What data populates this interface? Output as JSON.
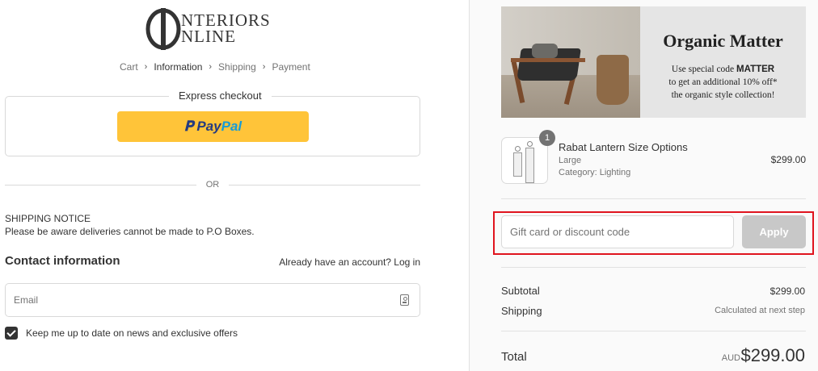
{
  "brand": {
    "logo_line1": "NTERIORS",
    "logo_line2": "NLINE",
    "logo_mark": "IO"
  },
  "breadcrumb": {
    "items": [
      "Cart",
      "Information",
      "Shipping",
      "Payment"
    ],
    "active": "Information"
  },
  "express": {
    "title": "Express checkout",
    "paypal_pay": "Pay",
    "paypal_pal": "Pal"
  },
  "divider_text": "OR",
  "notice": {
    "title": "SHIPPING NOTICE",
    "text": "Please be aware deliveries cannot be made to P.O Boxes."
  },
  "contact": {
    "heading": "Contact information",
    "account_prompt": "Already have an account?",
    "login_label": "Log in",
    "email_placeholder": "Email",
    "email_value": "",
    "newsletter_label": "Keep me up to date on news and exclusive offers",
    "newsletter_checked": true
  },
  "banner": {
    "title": "Organic Matter",
    "line1": "Use special code",
    "code": "MATTER",
    "line2": "to get an additional 10% off*",
    "line3": "the organic style collection!"
  },
  "product": {
    "quantity": "1",
    "name": "Rabat Lantern Size Options",
    "variant": "Large",
    "category": "Category: Lighting",
    "price": "$299.00"
  },
  "discount": {
    "placeholder": "Gift card or discount code",
    "value": "",
    "apply_label": "Apply"
  },
  "summary": {
    "subtotal_label": "Subtotal",
    "subtotal_value": "$299.00",
    "shipping_label": "Shipping",
    "shipping_value": "Calculated at next step",
    "total_label": "Total",
    "currency": "AUD",
    "total_value": "$299.00"
  },
  "colors": {
    "paypal_yellow": "#ffc439",
    "paypal_dark_blue": "#253b80",
    "paypal_light_blue": "#179bd7",
    "highlight_red": "#e0141e",
    "apply_disabled": "#c8c8c8"
  }
}
